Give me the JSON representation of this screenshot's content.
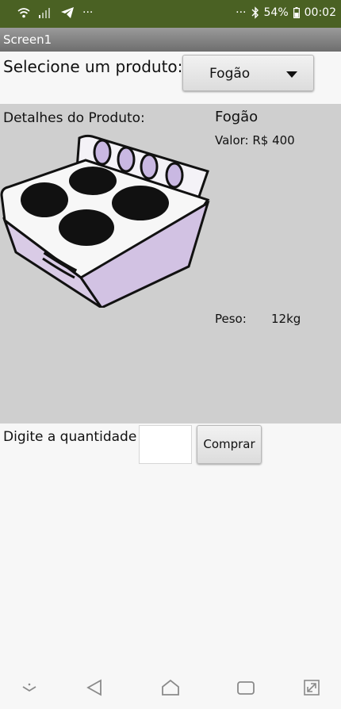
{
  "status_bar": {
    "left_dots": "···",
    "right_dots": "···",
    "battery": "54%",
    "time": "00:02",
    "icons": [
      "wifi-icon",
      "signal-icon",
      "telegram-icon",
      "bluetooth-icon",
      "battery-icon"
    ]
  },
  "title_bar": {
    "title": "Screen1"
  },
  "selector": {
    "label": "Selecione um produto:",
    "selected": "Fogão"
  },
  "details": {
    "label": "Detalhes do Produto:",
    "product_name": "Fogão",
    "price": "Valor: R$ 400",
    "weight_label": "Peso:",
    "weight_value": "12kg",
    "image": "stove-image"
  },
  "purchase": {
    "quantity_label": "Digite a quantidade",
    "quantity_value": "",
    "buy_label": "Comprar"
  },
  "nav_bar": {
    "icons": [
      "collapse-icon",
      "back-icon",
      "home-icon",
      "recents-icon",
      "expand-icon"
    ]
  },
  "colors": {
    "status_bar": "#4a6123",
    "details_bg": "#cfcfcf",
    "stove_body": "#d9cbe6"
  }
}
